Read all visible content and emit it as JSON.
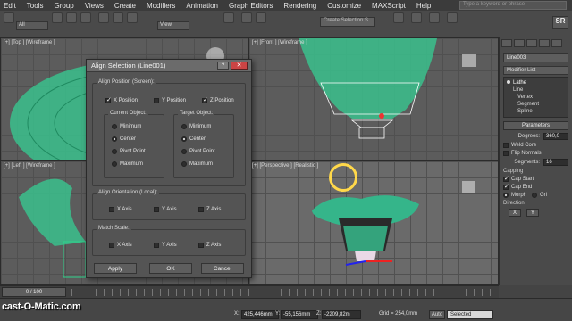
{
  "menu": {
    "items": [
      "Edit",
      "Tools",
      "Group",
      "Views",
      "Create",
      "Modifiers",
      "Animation",
      "Graph Editors",
      "Rendering",
      "Customize",
      "MAXScript",
      "Help"
    ],
    "search_placeholder": "Type a keyword or phrase"
  },
  "toolbar": {
    "filter_value": "All",
    "view_value": "View",
    "selection_set": "Create Selection S",
    "sr_label": "SR"
  },
  "viewports": {
    "top": "[+] [Top ] [Wireframe ]",
    "front": "[+] [Front ] [Wireframe ]",
    "left": "[+] [Left ] [Wireframe ]",
    "perspective": "[+] [Perspective ] [Realistic ]"
  },
  "dialog": {
    "title": "Align Selection (Line001)",
    "help": "?",
    "close": "✕",
    "align_position": "Align Position (Screen):",
    "x_position": "X Position",
    "y_position": "Y Position",
    "z_position": "Z Position",
    "current_object": "Current Object:",
    "target_object": "Target Object:",
    "minimum": "Minimum",
    "center": "Center",
    "pivot_point": "Pivot Point",
    "maximum": "Maximum",
    "align_orientation": "Align Orientation (Local):",
    "x_axis": "X Axis",
    "y_axis": "Y Axis",
    "z_axis": "Z Axis",
    "match_scale": "Match Scale:",
    "apply": "Apply",
    "ok": "OK",
    "cancel": "Cancel"
  },
  "command_panel": {
    "object_name": "Line003",
    "modifier_list": "Modifier List",
    "stack": [
      "Lathe",
      "Line",
      "Vertex",
      "Segment",
      "Spline"
    ],
    "parameters": "Parameters",
    "degrees_label": "Degrees:",
    "degrees_value": "360,0",
    "weld_core": "Weld Core",
    "flip_normals": "Flip Normals",
    "segments_label": "Segments:",
    "segments_value": "16",
    "capping": "Capping",
    "cap_start": "Cap Start",
    "cap_end": "Cap End",
    "morph": "Morph",
    "grid": "Gri",
    "direction": "Direction",
    "x": "X",
    "y": "Y"
  },
  "timeline": {
    "frame": "0 / 100"
  },
  "status": {
    "x_label": "X:",
    "x_value": "425,446mm",
    "y_label": "Y:",
    "y_value": "-55,156mm",
    "z_label": "Z:",
    "z_value": "-2209,82m",
    "grid": "Grid = 254,0mm",
    "auto": "Auto",
    "selected": "Selected"
  },
  "watermark": "cast-O-Matic.com",
  "colors": {
    "accent": "#ffd84a",
    "object_green": "#38b88a",
    "wire_green": "#2fd38c"
  }
}
